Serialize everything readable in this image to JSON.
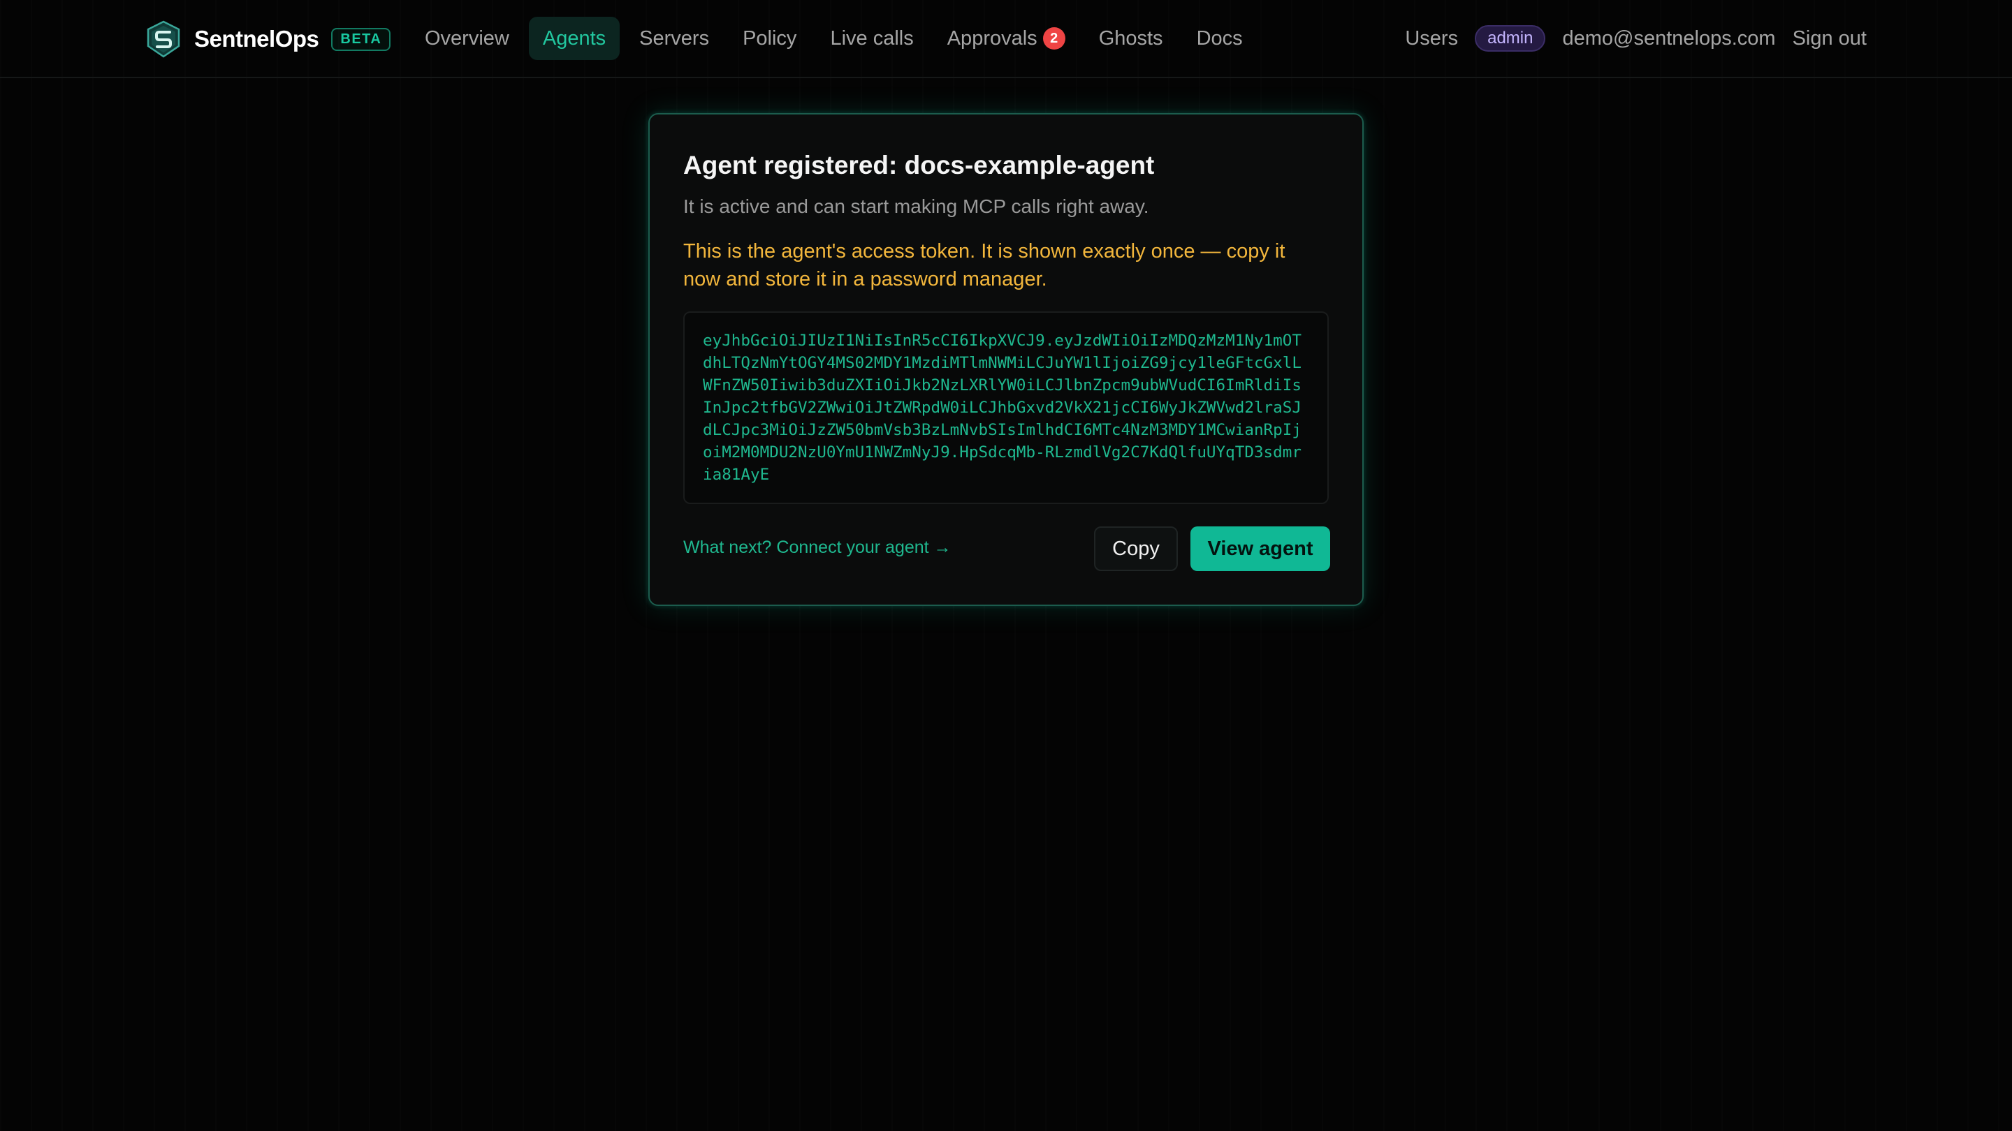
{
  "brand": {
    "name": "SentnelOps",
    "badge": "BETA",
    "logo_icon": "shield-s-logo-icon"
  },
  "nav": {
    "items": [
      {
        "label": "Overview"
      },
      {
        "label": "Agents",
        "active": true
      },
      {
        "label": "Servers"
      },
      {
        "label": "Policy"
      },
      {
        "label": "Live calls"
      },
      {
        "label": "Approvals",
        "badge": "2"
      },
      {
        "label": "Ghosts"
      },
      {
        "label": "Docs"
      }
    ]
  },
  "user": {
    "users_link": "Users",
    "role": "admin",
    "email": "demo@sentnelops.com",
    "sign_out": "Sign out"
  },
  "card": {
    "title": "Agent registered: docs-example-agent",
    "subtitle": "It is active and can start making MCP calls right away.",
    "warning": "This is the agent's access token. It is shown exactly once — copy it now and store it in a password manager.",
    "token": "eyJhbGciOiJIUzI1NiIsInR5cCI6IkpXVCJ9.eyJzdWIiOiIzMDQzMzM1Ny1mOTdhLTQzNmYtOGY4MS02MDY1MzdiMTlmNWMiLCJuYW1lIjoiZG9jcy1leGFtcGxlLWFnZW50Iiwib3duZXIiOiJkb2NzLXRlYW0iLCJlbnZpcm9ubWVudCI6ImRldiIsInJpc2tfbGV2ZWwiOiJtZWRpdW0iLCJhbGxvd2VkX21jcCI6WyJkZWVwd2lraSJdLCJpc3MiOiJzZW50bmVsb3BzLmNvbSIsImlhdCI6MTc4NzM3MDY1MCwianRpIjoiM2M0MDU2NzU0YmU1NWZmNyJ9.HpSdcqMb-RLzmdlVg2C7KdQlfuUYqTD3sdmria81AyE",
    "next_link": "What next? Connect your agent →",
    "copy_label": "Copy",
    "view_label": "View agent"
  },
  "colors": {
    "accent": "#10b895",
    "warning": "#f2b63c",
    "badge_red": "#ef4444",
    "role_badge": "#c4b5fd"
  }
}
